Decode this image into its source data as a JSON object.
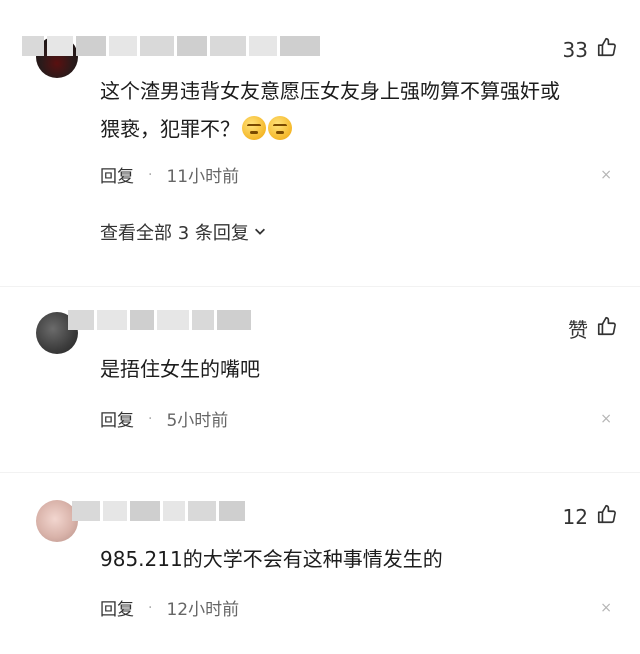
{
  "comments": [
    {
      "likes": "33",
      "text_line1": "这个渣男违背女友意愿压女友身上强吻算不算强奸或",
      "text_line2": "猥亵，犯罪不？",
      "emojis": [
        "smirk-emoji",
        "smirk-emoji"
      ],
      "reply_label": "回复",
      "time": "11小时前",
      "view_replies": "查看全部 3 条回复"
    },
    {
      "likes": "赞",
      "text": "是捂住女生的嘴吧",
      "reply_label": "回复",
      "time": "5小时前"
    },
    {
      "likes": "12",
      "text": "985.211的大学不会有这种事情发生的",
      "reply_label": "回复",
      "time": "12小时前"
    }
  ],
  "icons": {
    "like": "thumbs-up-icon",
    "close": "close-icon",
    "expand": "chevron-down-icon",
    "separator": "dot-separator"
  },
  "glyphs": {
    "dot": "·",
    "close": "×"
  },
  "colors": {
    "text": "#1c1c1c",
    "meta": "#666666",
    "placeholder": "#d9d9d9"
  }
}
